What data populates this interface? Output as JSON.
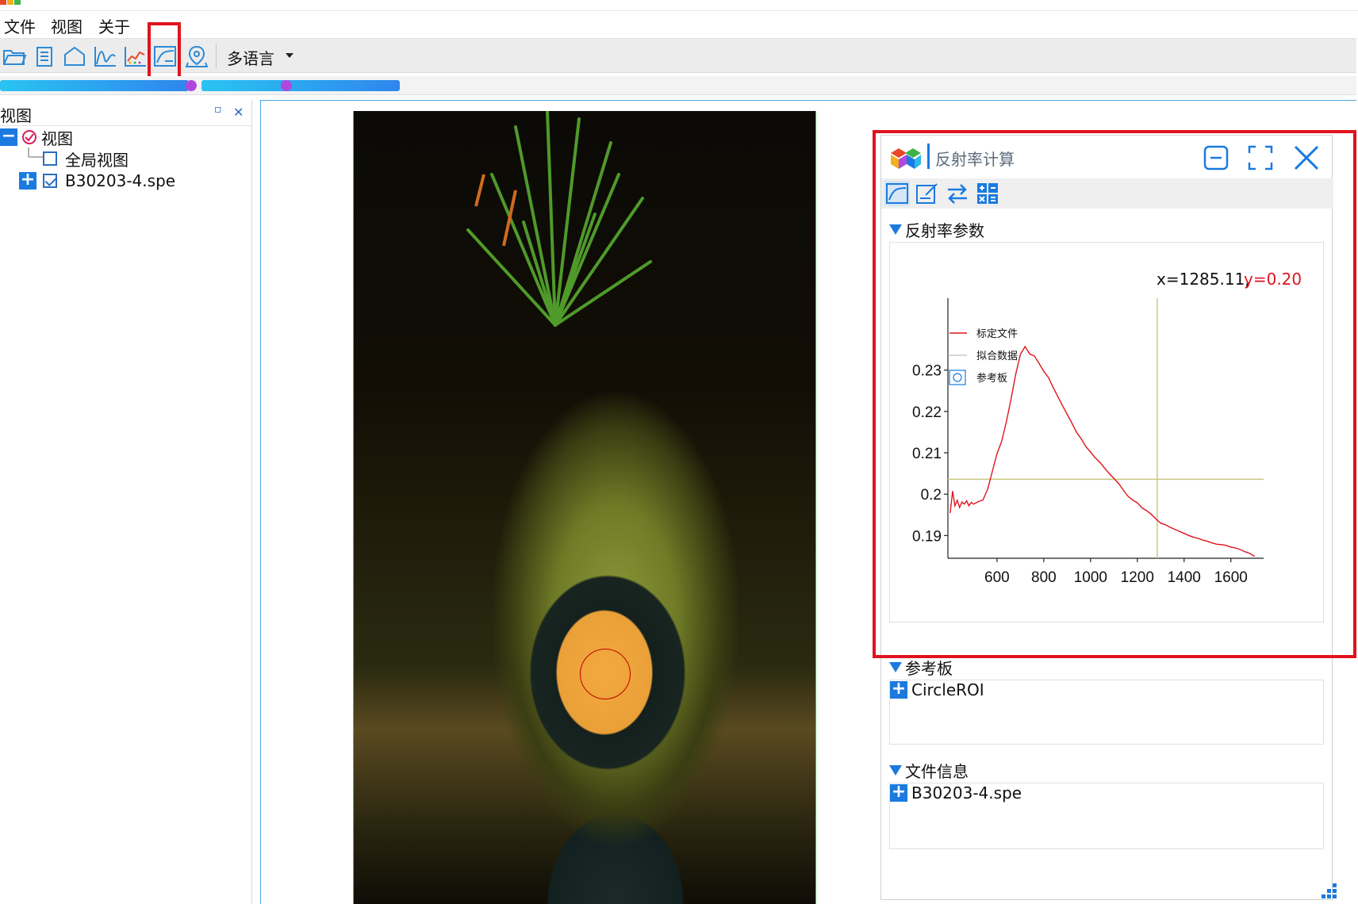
{
  "menu": {
    "items": [
      "文件",
      "视图",
      "关于"
    ]
  },
  "toolbar": {
    "tools": [
      "open-folder-icon",
      "document-icon",
      "home-outline-icon",
      "spectrum-curve-icon",
      "heatmap-chart-icon",
      "reflectance-icon",
      "map-pin-icon"
    ],
    "language_label": "多语言"
  },
  "progress": [
    {
      "name": "progress-bar-1",
      "value_fraction": 0.99
    },
    {
      "name": "progress-bar-2",
      "value_fraction": 0.4
    }
  ],
  "left_dock": {
    "title": "视图",
    "float_icon": "▫",
    "close_icon": "✕",
    "tree": {
      "root": "视图",
      "children": [
        {
          "label": "全局视图",
          "checked": false
        },
        {
          "label": "B30203-4.spe",
          "checked": true
        }
      ]
    }
  },
  "dialog": {
    "title": "反射率计算",
    "sections": {
      "params": "反射率参数",
      "reference": "参考板",
      "fileinfo": "文件信息"
    },
    "reference_items": [
      "CircleROI"
    ],
    "file_items": [
      "B30203-4.spe"
    ],
    "readout": {
      "x_text": "x=1285.11,",
      "y_text": "y=0.20"
    }
  },
  "chart_data": {
    "type": "line",
    "title": "",
    "xlabel": "",
    "ylabel": "",
    "xlim": [
      390,
      1740
    ],
    "ylim": [
      0.1845,
      0.2474
    ],
    "xticks": [
      600,
      800,
      1000,
      1200,
      1400,
      1600
    ],
    "yticks": [
      0.19,
      0.2,
      0.21,
      0.22,
      0.23
    ],
    "ytick_labels": [
      "0.19",
      "0.2",
      "0.21",
      "0.22",
      "0.23"
    ],
    "legend": [
      {
        "name": "标定文件",
        "color": "#e0141e"
      },
      {
        "name": "拟合数据",
        "color": "#c8c8c8"
      },
      {
        "name": "参考板",
        "color": "#1a7ae0"
      }
    ],
    "legend_position": "top-left",
    "crosshair": {
      "x": 1285.11,
      "y": 0.2036
    },
    "series": [
      {
        "name": "标定文件",
        "color": "#e0141e",
        "x": [
          400,
          410,
          420,
          430,
          440,
          450,
          460,
          470,
          480,
          490,
          500,
          520,
          540,
          560,
          580,
          600,
          620,
          640,
          660,
          680,
          700,
          720,
          740,
          760,
          780,
          800,
          820,
          840,
          860,
          880,
          900,
          920,
          940,
          960,
          980,
          1000,
          1020,
          1040,
          1060,
          1080,
          1100,
          1120,
          1140,
          1160,
          1180,
          1200,
          1220,
          1240,
          1260,
          1280,
          1300,
          1320,
          1340,
          1360,
          1380,
          1400,
          1420,
          1440,
          1460,
          1480,
          1500,
          1520,
          1540,
          1560,
          1580,
          1600,
          1620,
          1640,
          1660,
          1680,
          1700
        ],
        "y": [
          0.1955,
          0.2007,
          0.1972,
          0.1985,
          0.1968,
          0.1981,
          0.1976,
          0.1984,
          0.1972,
          0.198,
          0.1976,
          0.1982,
          0.1986,
          0.2012,
          0.2055,
          0.2098,
          0.2128,
          0.2175,
          0.223,
          0.229,
          0.2338,
          0.2357,
          0.2339,
          0.2334,
          0.2316,
          0.2297,
          0.2282,
          0.2258,
          0.2236,
          0.2214,
          0.2193,
          0.2172,
          0.215,
          0.2134,
          0.2115,
          0.2102,
          0.2088,
          0.2077,
          0.2063,
          0.205,
          0.2038,
          0.2026,
          0.201,
          0.1995,
          0.1986,
          0.1979,
          0.1967,
          0.196,
          0.1951,
          0.194,
          0.193,
          0.1926,
          0.192,
          0.1915,
          0.191,
          0.1905,
          0.19,
          0.1896,
          0.1893,
          0.1889,
          0.1886,
          0.1882,
          0.1879,
          0.1878,
          0.1876,
          0.1872,
          0.187,
          0.1866,
          0.1861,
          0.1857,
          0.185
        ]
      }
    ]
  },
  "colors": {
    "accent": "#1a7ae0",
    "highlight": "#e0141e",
    "crosshair": "#c8c880"
  }
}
